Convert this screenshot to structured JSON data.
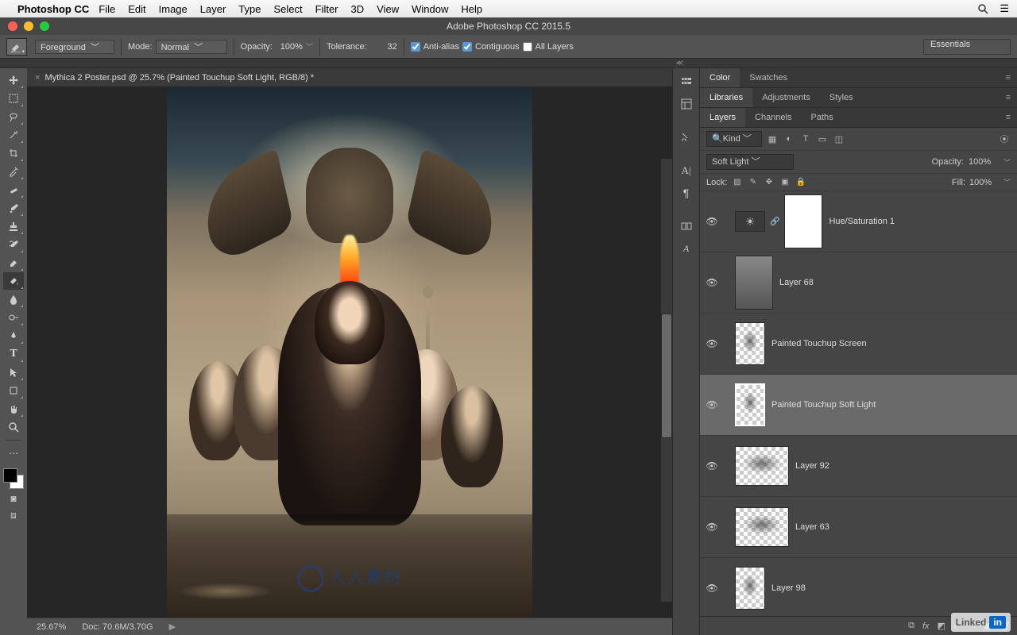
{
  "menubar": {
    "app": "Photoshop CC",
    "items": [
      "File",
      "Edit",
      "Image",
      "Layer",
      "Type",
      "Select",
      "Filter",
      "3D",
      "View",
      "Window",
      "Help"
    ]
  },
  "window": {
    "title": "Adobe Photoshop CC 2015.5"
  },
  "options": {
    "fill_mode": "Foreground",
    "mode_label": "Mode:",
    "mode_value": "Normal",
    "opacity_label": "Opacity:",
    "opacity_value": "100%",
    "tolerance_label": "Tolerance:",
    "tolerance_value": "32",
    "antialias": "Anti-alias",
    "contiguous": "Contiguous",
    "all_layers": "All Layers",
    "workspace": "Essentials"
  },
  "document": {
    "tab_title": "Mythica 2 Poster.psd @ 25.7% (Painted Touchup Soft Light, RGB/8) *",
    "zoom": "25.67%",
    "doc_info": "Doc: 70.6M/3.70G",
    "watermark": "人人素材"
  },
  "panelGroups": {
    "color": {
      "tabs": [
        "Color",
        "Swatches"
      ],
      "active": 0
    },
    "libraries": {
      "tabs": [
        "Libraries",
        "Adjustments",
        "Styles"
      ],
      "active": 0
    },
    "layers": {
      "tabs": [
        "Layers",
        "Channels",
        "Paths"
      ],
      "active": 0
    }
  },
  "layersPanel": {
    "filter": "Kind",
    "blend_mode": "Soft Light",
    "opacity_label": "Opacity:",
    "opacity": "100%",
    "lock_label": "Lock:",
    "fill_label": "Fill:",
    "fill": "100%",
    "layers": [
      {
        "name": "Hue/Saturation 1",
        "type": "adjustment",
        "visible": true,
        "selected": false
      },
      {
        "name": "Layer 68",
        "type": "pixel",
        "visible": true,
        "selected": false
      },
      {
        "name": "Painted Touchup Screen",
        "type": "pixel-checker",
        "visible": true,
        "selected": false
      },
      {
        "name": "Painted Touchup Soft Light",
        "type": "pixel-checker",
        "visible": true,
        "selected": true
      },
      {
        "name": "Layer 92",
        "type": "pixel-checker-wide",
        "visible": true,
        "selected": false
      },
      {
        "name": "Layer 63",
        "type": "pixel-checker-wide",
        "visible": true,
        "selected": false
      },
      {
        "name": "Layer 98",
        "type": "pixel-checker",
        "visible": true,
        "selected": false
      }
    ]
  },
  "branding": {
    "linked": "Linked",
    "in": "in"
  }
}
